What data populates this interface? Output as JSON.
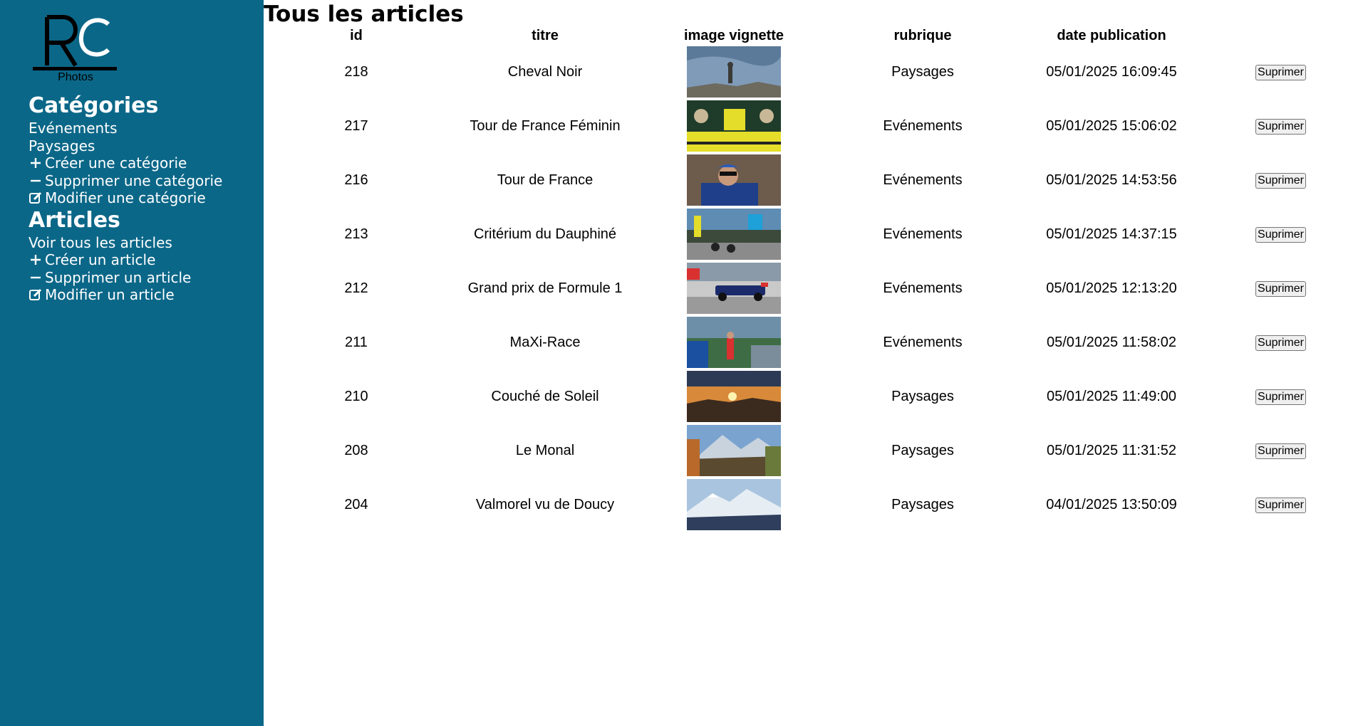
{
  "logo": {
    "caption": "Photos"
  },
  "sidebar": {
    "categories_heading": "Catégories",
    "category_links": [
      "Evénements",
      "Paysages"
    ],
    "category_actions": [
      {
        "icon": "plus-icon",
        "label": "Créer une catégorie"
      },
      {
        "icon": "minus-icon",
        "label": "Supprimer une catégorie"
      },
      {
        "icon": "edit-icon",
        "label": "Modifier une catégorie"
      }
    ],
    "articles_heading": "Articles",
    "article_links": [
      {
        "icon": "",
        "label": "Voir tous les articles"
      },
      {
        "icon": "plus-icon",
        "label": "Créer un article"
      },
      {
        "icon": "minus-icon",
        "label": "Supprimer un article"
      },
      {
        "icon": "edit-icon",
        "label": "Modifier un article"
      }
    ]
  },
  "main": {
    "title": "Tous les articles",
    "columns": [
      "id",
      "titre",
      "image vignette",
      "rubrique",
      "date publication",
      ""
    ],
    "delete_label": "Suprimer",
    "rows": [
      {
        "id": "218",
        "titre": "Cheval Noir",
        "rubrique": "Paysages",
        "date": "05/01/2025 16:09:45",
        "thumb": "mountain-summit-statue"
      },
      {
        "id": "217",
        "titre": "Tour de France Féminin",
        "rubrique": "Evénements",
        "date": "05/01/2025 15:06:02",
        "thumb": "cycling-fan-zone"
      },
      {
        "id": "216",
        "titre": "Tour de France",
        "rubrique": "Evénements",
        "date": "05/01/2025 14:53:56",
        "thumb": "cyclist-portrait"
      },
      {
        "id": "213",
        "titre": "Critérium du Dauphiné",
        "rubrique": "Evénements",
        "date": "05/01/2025 14:37:15",
        "thumb": "cycling-finish"
      },
      {
        "id": "212",
        "titre": "Grand prix de Formule 1",
        "rubrique": "Evénements",
        "date": "05/01/2025 12:13:20",
        "thumb": "f1-car"
      },
      {
        "id": "211",
        "titre": "MaXi-Race",
        "rubrique": "Evénements",
        "date": "05/01/2025 11:58:02",
        "thumb": "trail-race"
      },
      {
        "id": "210",
        "titre": "Couché de Soleil",
        "rubrique": "Paysages",
        "date": "05/01/2025 11:49:00",
        "thumb": "sunset"
      },
      {
        "id": "208",
        "titre": "Le Monal",
        "rubrique": "Paysages",
        "date": "05/01/2025 11:31:52",
        "thumb": "mountain-village"
      },
      {
        "id": "204",
        "titre": "Valmorel vu de Doucy",
        "rubrique": "Paysages",
        "date": "04/01/2025 13:50:09",
        "thumb": "snowy-mountain"
      }
    ]
  },
  "colors": {
    "sidebar": "#0b6788",
    "background": "#ffffff",
    "text": "#000000"
  }
}
